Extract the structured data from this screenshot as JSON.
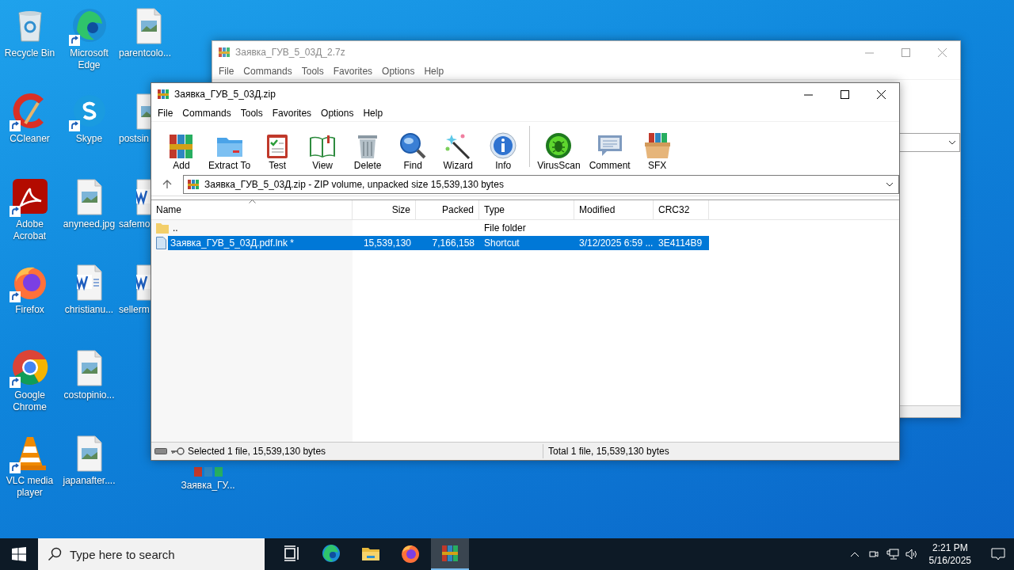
{
  "desktop_columns": [
    {
      "icons": [
        {
          "label": "Recycle Bin",
          "kind": "recycle",
          "shortcut": false
        },
        {
          "label": "CCleaner",
          "kind": "ccleaner",
          "shortcut": true
        },
        {
          "label": "Adobe Acrobat",
          "kind": "acrobat",
          "shortcut": true
        },
        {
          "label": "Firefox",
          "kind": "firefox",
          "shortcut": true
        },
        {
          "label": "Google Chrome",
          "kind": "chrome",
          "shortcut": true
        },
        {
          "label": "VLC media player",
          "kind": "vlc",
          "shortcut": true
        }
      ]
    },
    {
      "icons": [
        {
          "label": "Microsoft Edge",
          "kind": "edge",
          "shortcut": true
        },
        {
          "label": "Skype",
          "kind": "skype",
          "shortcut": true
        },
        {
          "label": "anyneed.jpg",
          "kind": "image",
          "shortcut": false
        },
        {
          "label": "christianu...",
          "kind": "word",
          "shortcut": false
        },
        {
          "label": "costopinio...",
          "kind": "image",
          "shortcut": false
        },
        {
          "label": "japanafter....",
          "kind": "image",
          "shortcut": false
        }
      ]
    },
    {
      "icons": [
        {
          "label": "parentcolo...",
          "kind": "image",
          "shortcut": false
        },
        {
          "label": "postsin",
          "kind": "image",
          "shortcut": false
        },
        {
          "label": "safemo",
          "kind": "word",
          "shortcut": false
        },
        {
          "label": "sellerm",
          "kind": "word",
          "shortcut": false
        }
      ]
    },
    {
      "icons": [
        {
          "label": "Заявка_ГУ...",
          "kind": "winrar",
          "shortcut": false
        }
      ]
    }
  ],
  "back_window": {
    "title": "Заявка_ГУВ_5_03Д_2.7z",
    "active": false,
    "menu": [
      "File",
      "Commands",
      "Tools",
      "Favorites",
      "Options",
      "Help"
    ]
  },
  "window": {
    "title": "Заявка_ГУВ_5_03Д.zip",
    "active": true,
    "menu": [
      "File",
      "Commands",
      "Tools",
      "Favorites",
      "Options",
      "Help"
    ],
    "toolbar": [
      {
        "label": "Add",
        "kind": "add"
      },
      {
        "label": "Extract To",
        "kind": "extract"
      },
      {
        "label": "Test",
        "kind": "test"
      },
      {
        "label": "View",
        "kind": "view"
      },
      {
        "label": "Delete",
        "kind": "delete"
      },
      {
        "label": "Find",
        "kind": "find"
      },
      {
        "label": "Wizard",
        "kind": "wizard"
      },
      {
        "label": "Info",
        "kind": "info"
      },
      {
        "label": "VirusScan",
        "kind": "virusscan"
      },
      {
        "label": "Comment",
        "kind": "comment"
      },
      {
        "label": "SFX",
        "kind": "sfx"
      }
    ],
    "address": "Заявка_ГУВ_5_03Д.zip - ZIP volume, unpacked size 15,539,130 bytes",
    "columns": [
      "Name",
      "Size",
      "Packed",
      "Type",
      "Modified",
      "CRC32"
    ],
    "rows": [
      {
        "kind": "folder",
        "selected": false,
        "cells": [
          "..",
          "",
          "",
          "File folder",
          "",
          ""
        ]
      },
      {
        "kind": "file",
        "selected": true,
        "cells": [
          "Заявка_ГУВ_5_03Д.pdf.lnk *",
          "15,539,130",
          "7,166,158",
          "Shortcut",
          "3/12/2025 6:59 ...",
          "3E4114B9"
        ]
      }
    ],
    "status_left": "Selected 1 file, 15,539,130 bytes",
    "status_right": "Total 1 file, 15,539,130 bytes"
  },
  "taskbar": {
    "search_placeholder": "Type here to search",
    "apps": [
      {
        "kind": "taskview",
        "active": false
      },
      {
        "kind": "edge",
        "active": false
      },
      {
        "kind": "explorer",
        "active": false
      },
      {
        "kind": "firefox",
        "active": false
      },
      {
        "kind": "winrar",
        "active": true
      }
    ],
    "time": "2:21 PM",
    "date": "5/16/2025"
  }
}
